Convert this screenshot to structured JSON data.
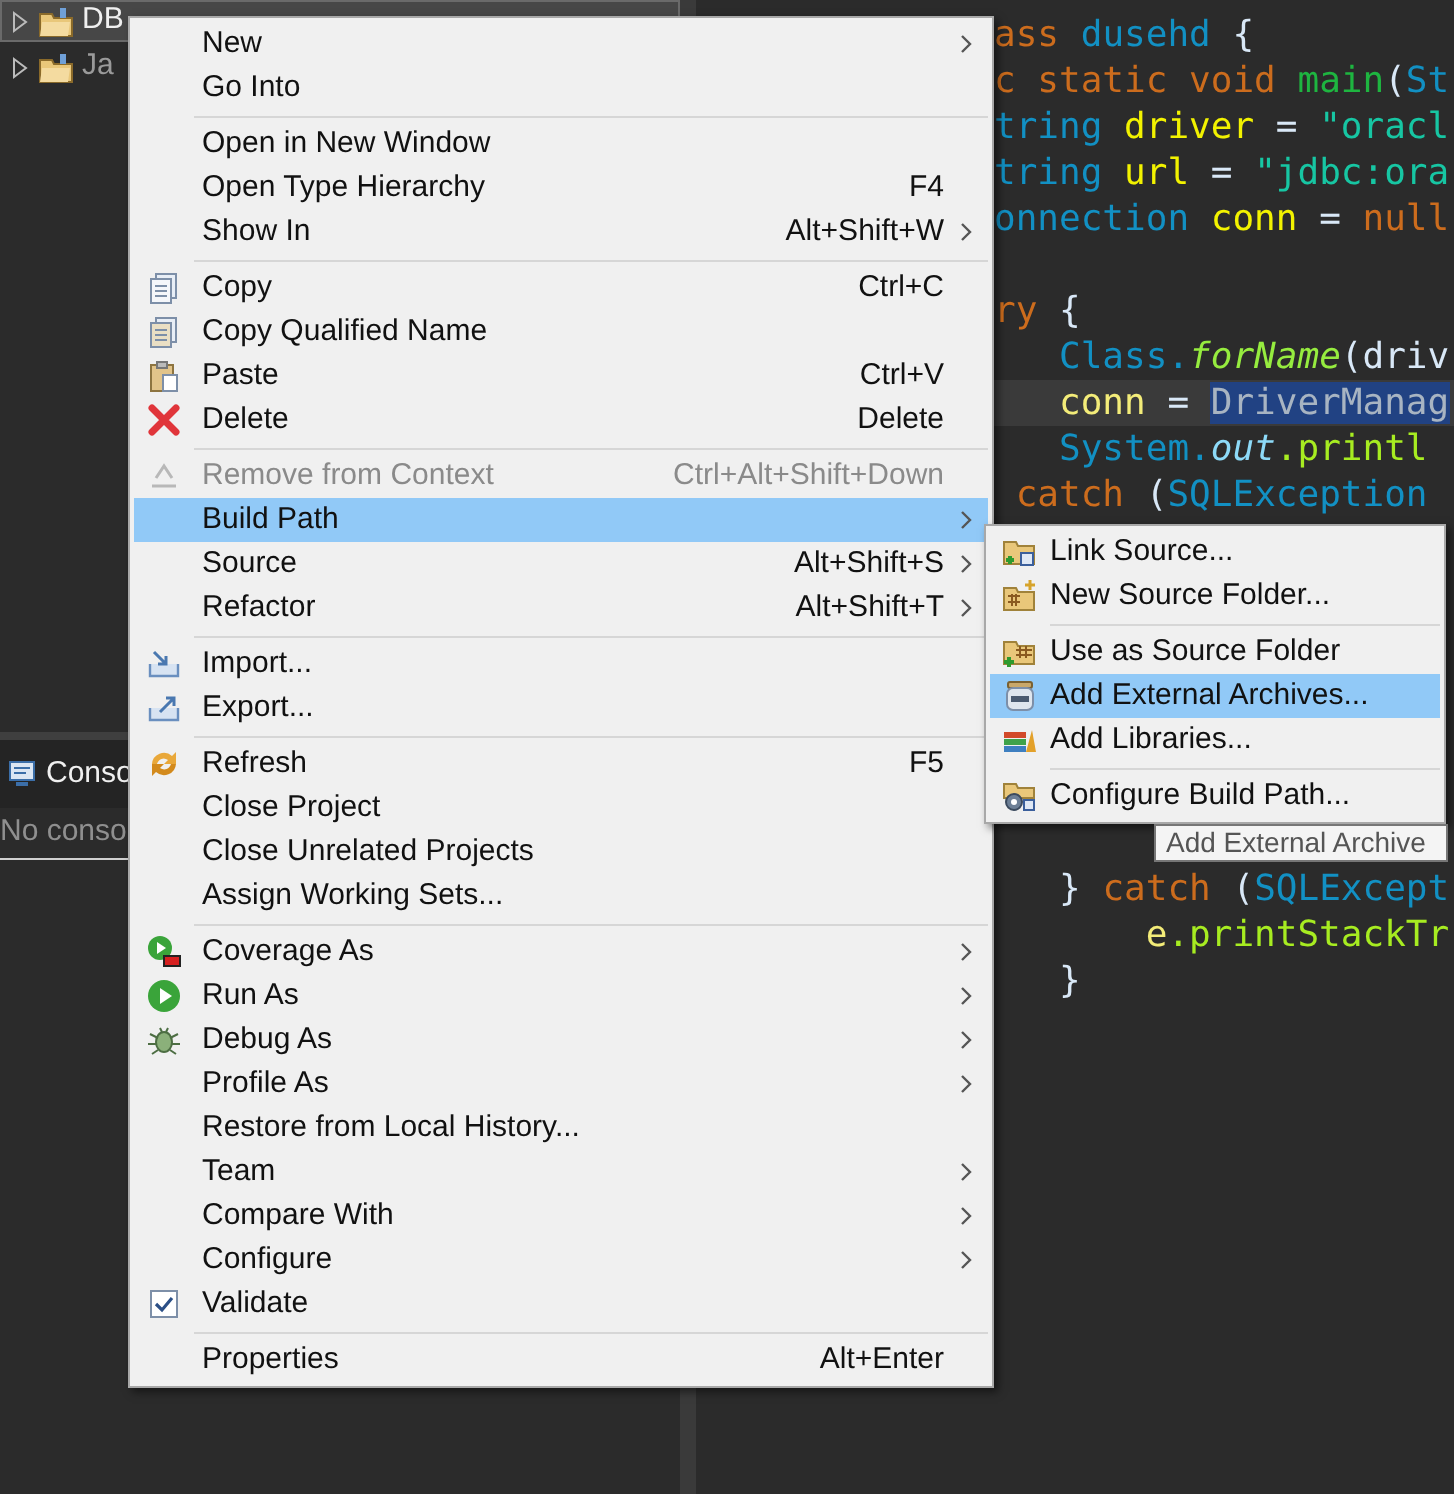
{
  "explorer": {
    "tree": [
      {
        "label": "DB",
        "selected": true
      },
      {
        "label": "Ja",
        "selected": false
      }
    ],
    "console": {
      "tab": "Conso",
      "message": "No conso"
    }
  },
  "editor": {
    "blocks": [
      {
        "lines": [
          {
            "current": false,
            "tokens": [
              {
                "kind": "keyword",
                "text": "ass"
              },
              {
                "kind": "type",
                "text": " dusehd"
              },
              {
                "kind": "plain",
                "text": " {"
              }
            ]
          },
          {
            "current": false,
            "tokens": [
              {
                "kind": "keyword",
                "text": "c static void"
              },
              {
                "kind": "method",
                "text": " main"
              },
              {
                "kind": "plain",
                "text": "("
              },
              {
                "kind": "type",
                "text": "St"
              }
            ]
          },
          {
            "current": false,
            "tokens": [
              {
                "kind": "type",
                "text": "tring"
              },
              {
                "kind": "field",
                "text": " driver"
              },
              {
                "kind": "plain",
                "text": " = "
              },
              {
                "kind": "string",
                "text": "\"oracl"
              }
            ]
          },
          {
            "current": false,
            "tokens": [
              {
                "kind": "type",
                "text": "tring"
              },
              {
                "kind": "field",
                "text": " url"
              },
              {
                "kind": "plain",
                "text": " = "
              },
              {
                "kind": "string",
                "text": "\"jdbc:ora"
              }
            ]
          },
          {
            "current": false,
            "tokens": [
              {
                "kind": "type",
                "text": "onnection"
              },
              {
                "kind": "field",
                "text": " conn"
              },
              {
                "kind": "plain",
                "text": " = "
              },
              {
                "kind": "keyword",
                "text": "null"
              }
            ]
          }
        ]
      },
      {
        "lines": [
          {
            "current": false,
            "tokens": [
              {
                "kind": "keyword",
                "text": "ry"
              },
              {
                "kind": "plain",
                "text": " {"
              }
            ]
          },
          {
            "current": false,
            "tokens": [
              {
                "kind": "type",
                "text": "   Class."
              },
              {
                "kind": "static_method",
                "text": "forName"
              },
              {
                "kind": "plain",
                "text": "(driv"
              }
            ]
          },
          {
            "current": true,
            "tokens": [
              {
                "kind": "local",
                "text": "   conn"
              },
              {
                "kind": "plain",
                "text": " = "
              },
              {
                "kind": "selection",
                "text": "DriverManag"
              }
            ]
          },
          {
            "current": false,
            "tokens": [
              {
                "kind": "type",
                "text": "   System."
              },
              {
                "kind": "static_field",
                "text": "out"
              },
              {
                "kind": "call",
                "text": ".printl"
              }
            ]
          },
          {
            "current": false,
            "tokens": [
              {
                "kind": "keyword",
                "text": " catch"
              },
              {
                "kind": "plain",
                "text": " ("
              },
              {
                "kind": "type",
                "text": "SQLException"
              }
            ]
          }
        ]
      },
      {
        "lines": [
          {
            "current": false,
            "tokens": [
              {
                "kind": "plain",
                "text": "   }"
              },
              {
                "kind": "keyword",
                "text": " catch"
              },
              {
                "kind": "plain",
                "text": " ("
              },
              {
                "kind": "type",
                "text": "SQLExcept"
              }
            ]
          },
          {
            "current": false,
            "tokens": [
              {
                "kind": "local",
                "text": "       e"
              },
              {
                "kind": "call",
                "text": ".printStackTr"
              }
            ]
          },
          {
            "current": false,
            "tokens": [
              {
                "kind": "plain",
                "text": "   }"
              }
            ]
          }
        ]
      }
    ]
  },
  "context_menu": {
    "items": [
      {
        "kind": "command",
        "label": "New",
        "submenu": true,
        "selected": false,
        "disabled": false
      },
      {
        "kind": "command",
        "label": "Go Into",
        "submenu": false,
        "selected": false,
        "disabled": false
      },
      {
        "kind": "separator"
      },
      {
        "kind": "command",
        "label": "Open in New Window",
        "submenu": false,
        "selected": false,
        "disabled": false
      },
      {
        "kind": "command",
        "label": "Open Type Hierarchy",
        "shortcut": "F4",
        "submenu": false,
        "selected": false,
        "disabled": false
      },
      {
        "kind": "command",
        "label": "Show In",
        "shortcut": "Alt+Shift+W",
        "submenu": true,
        "selected": false,
        "disabled": false
      },
      {
        "kind": "separator"
      },
      {
        "kind": "command",
        "label": "Copy",
        "shortcut": "Ctrl+C",
        "submenu": false,
        "selected": false,
        "disabled": false
      },
      {
        "kind": "command",
        "label": "Copy Qualified Name",
        "submenu": false,
        "selected": false,
        "disabled": false
      },
      {
        "kind": "command",
        "label": "Paste",
        "shortcut": "Ctrl+V",
        "submenu": false,
        "selected": false,
        "disabled": false
      },
      {
        "kind": "command",
        "label": "Delete",
        "shortcut": "Delete",
        "submenu": false,
        "selected": false,
        "disabled": false
      },
      {
        "kind": "separator"
      },
      {
        "kind": "command",
        "label": "Remove from Context",
        "shortcut": "Ctrl+Alt+Shift+Down",
        "submenu": false,
        "selected": false,
        "disabled": true
      },
      {
        "kind": "command",
        "label": "Build Path",
        "submenu": true,
        "selected": true,
        "disabled": false
      },
      {
        "kind": "command",
        "label": "Source",
        "shortcut": "Alt+Shift+S",
        "submenu": true,
        "selected": false,
        "disabled": false
      },
      {
        "kind": "command",
        "label": "Refactor",
        "shortcut": "Alt+Shift+T",
        "submenu": true,
        "selected": false,
        "disabled": false
      },
      {
        "kind": "separator"
      },
      {
        "kind": "command",
        "label": "Import...",
        "submenu": false,
        "selected": false,
        "disabled": false
      },
      {
        "kind": "command",
        "label": "Export...",
        "submenu": false,
        "selected": false,
        "disabled": false
      },
      {
        "kind": "separator"
      },
      {
        "kind": "command",
        "label": "Refresh",
        "shortcut": "F5",
        "submenu": false,
        "selected": false,
        "disabled": false
      },
      {
        "kind": "command",
        "label": "Close Project",
        "submenu": false,
        "selected": false,
        "disabled": false
      },
      {
        "kind": "command",
        "label": "Close Unrelated Projects",
        "submenu": false,
        "selected": false,
        "disabled": false
      },
      {
        "kind": "command",
        "label": "Assign Working Sets...",
        "submenu": false,
        "selected": false,
        "disabled": false
      },
      {
        "kind": "separator"
      },
      {
        "kind": "command",
        "label": "Coverage As",
        "submenu": true,
        "selected": false,
        "disabled": false
      },
      {
        "kind": "command",
        "label": "Run As",
        "submenu": true,
        "selected": false,
        "disabled": false
      },
      {
        "kind": "command",
        "label": "Debug As",
        "submenu": true,
        "selected": false,
        "disabled": false
      },
      {
        "kind": "command",
        "label": "Profile As",
        "submenu": true,
        "selected": false,
        "disabled": false
      },
      {
        "kind": "command",
        "label": "Restore from Local History...",
        "submenu": false,
        "selected": false,
        "disabled": false
      },
      {
        "kind": "command",
        "label": "Team",
        "submenu": true,
        "selected": false,
        "disabled": false
      },
      {
        "kind": "command",
        "label": "Compare With",
        "submenu": true,
        "selected": false,
        "disabled": false
      },
      {
        "kind": "command",
        "label": "Configure",
        "submenu": true,
        "selected": false,
        "disabled": false
      },
      {
        "kind": "check",
        "label": "Validate",
        "checked": true,
        "submenu": false,
        "selected": false,
        "disabled": false
      },
      {
        "kind": "separator"
      },
      {
        "kind": "command",
        "label": "Properties",
        "shortcut": "Alt+Enter",
        "submenu": false,
        "selected": false,
        "disabled": false
      }
    ]
  },
  "submenu": {
    "items": [
      {
        "kind": "command",
        "label": "Link Source...",
        "selected": false
      },
      {
        "kind": "command",
        "label": "New Source Folder...",
        "selected": false
      },
      {
        "kind": "separator"
      },
      {
        "kind": "command",
        "label": "Use as Source Folder",
        "selected": false
      },
      {
        "kind": "command",
        "label": "Add External Archives...",
        "selected": true
      },
      {
        "kind": "command",
        "label": "Add Libraries...",
        "selected": false
      },
      {
        "kind": "separator"
      },
      {
        "kind": "command",
        "label": "Configure Build Path...",
        "selected": false
      }
    ]
  },
  "tooltip": {
    "text": "Add External Archive"
  }
}
